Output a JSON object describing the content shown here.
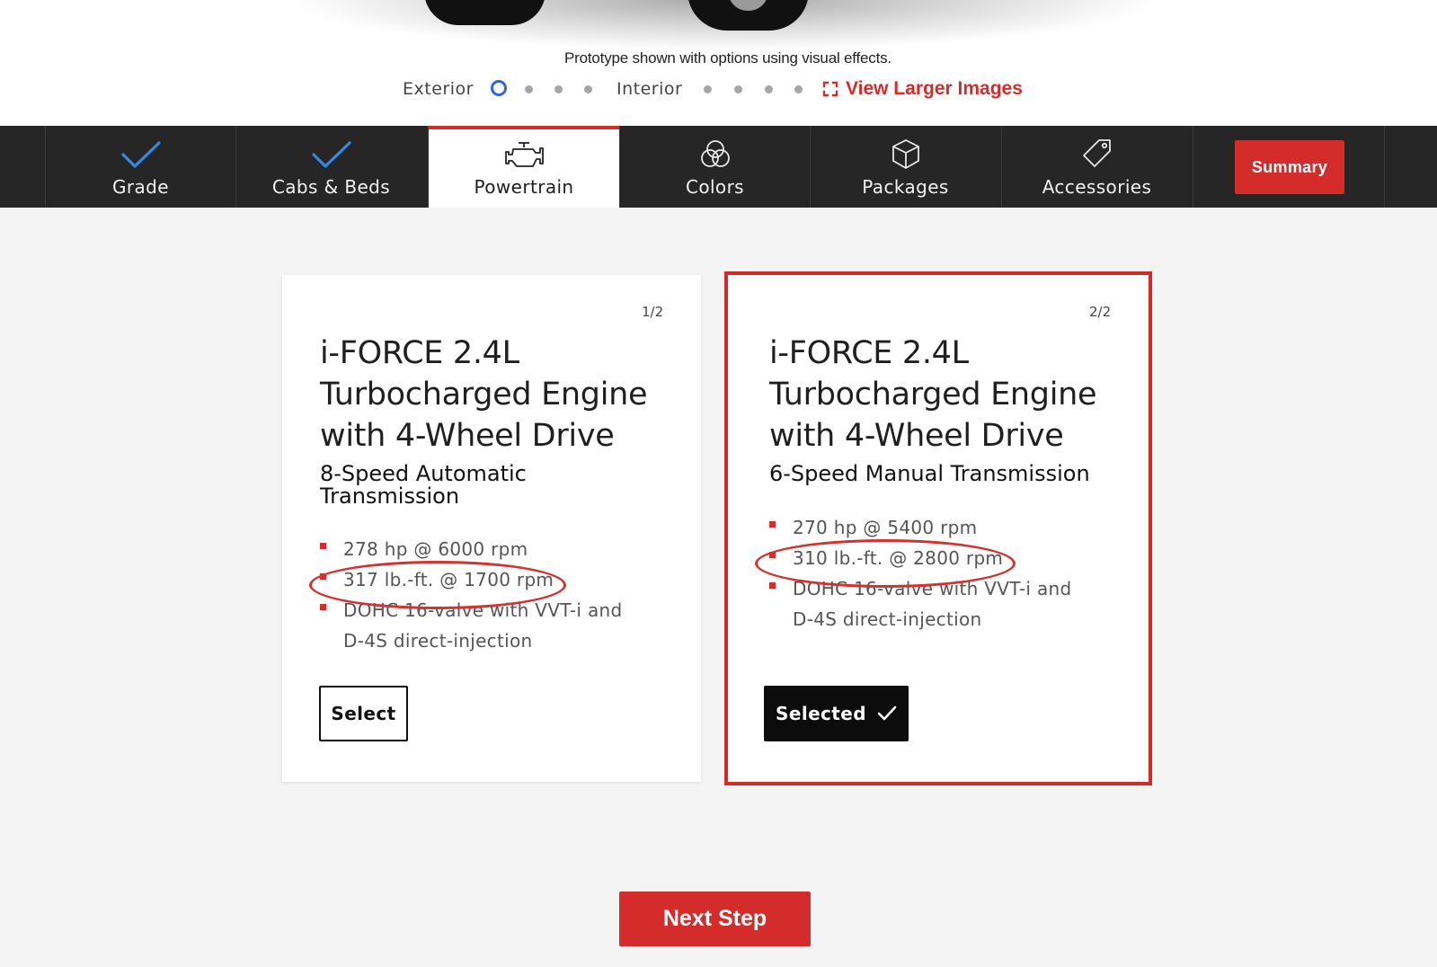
{
  "hero": {
    "disclaimer": "Prototype shown with options using visual effects.",
    "gallery": {
      "exterior_label": "Exterior",
      "interior_label": "Interior",
      "view_larger_label": "View Larger Images"
    }
  },
  "nav": {
    "items": [
      {
        "label": "Grade",
        "icon": "checkmark-icon",
        "state": "completed"
      },
      {
        "label": "Cabs & Beds",
        "icon": "checkmark-icon",
        "state": "completed"
      },
      {
        "label": "Powertrain",
        "icon": "engine-icon",
        "state": "active"
      },
      {
        "label": "Colors",
        "icon": "color-circles-icon",
        "state": "default"
      },
      {
        "label": "Packages",
        "icon": "box-icon",
        "state": "default"
      },
      {
        "label": "Accessories",
        "icon": "tag-icon",
        "state": "default"
      }
    ],
    "summary_label": "Summary"
  },
  "cards": [
    {
      "counter": "1/2",
      "title_lines": [
        "i-FORCE 2.4L",
        "Turbocharged Engine",
        "with 4-Wheel Drive"
      ],
      "subtitle_lines": [
        "8-Speed Automatic",
        "Transmission"
      ],
      "specs": [
        "278 hp @ 6000 rpm",
        "317 lb.-ft. @ 1700 rpm",
        "DOHC 16-valve with VVT-i and",
        "D-4S direct-injection"
      ],
      "button_label": "Select",
      "selected": false
    },
    {
      "counter": "2/2",
      "title_lines": [
        "i-FORCE 2.4L",
        "Turbocharged Engine",
        "with 4-Wheel Drive"
      ],
      "subtitle_lines": [
        "6-Speed Manual Transmission"
      ],
      "specs": [
        "270 hp @ 5400 rpm",
        "310 lb.-ft. @ 2800 rpm",
        "DOHC 16-valve with VVT-i and",
        "D-4S direct-injection"
      ],
      "button_label": "Selected",
      "selected": true
    }
  ],
  "next_step_label": "Next Step",
  "colors": {
    "brand_red": "#d12d2d",
    "nav_bg": "#262626",
    "check_blue": "#2f8be6",
    "active_dot_blue": "#2f67d6"
  }
}
